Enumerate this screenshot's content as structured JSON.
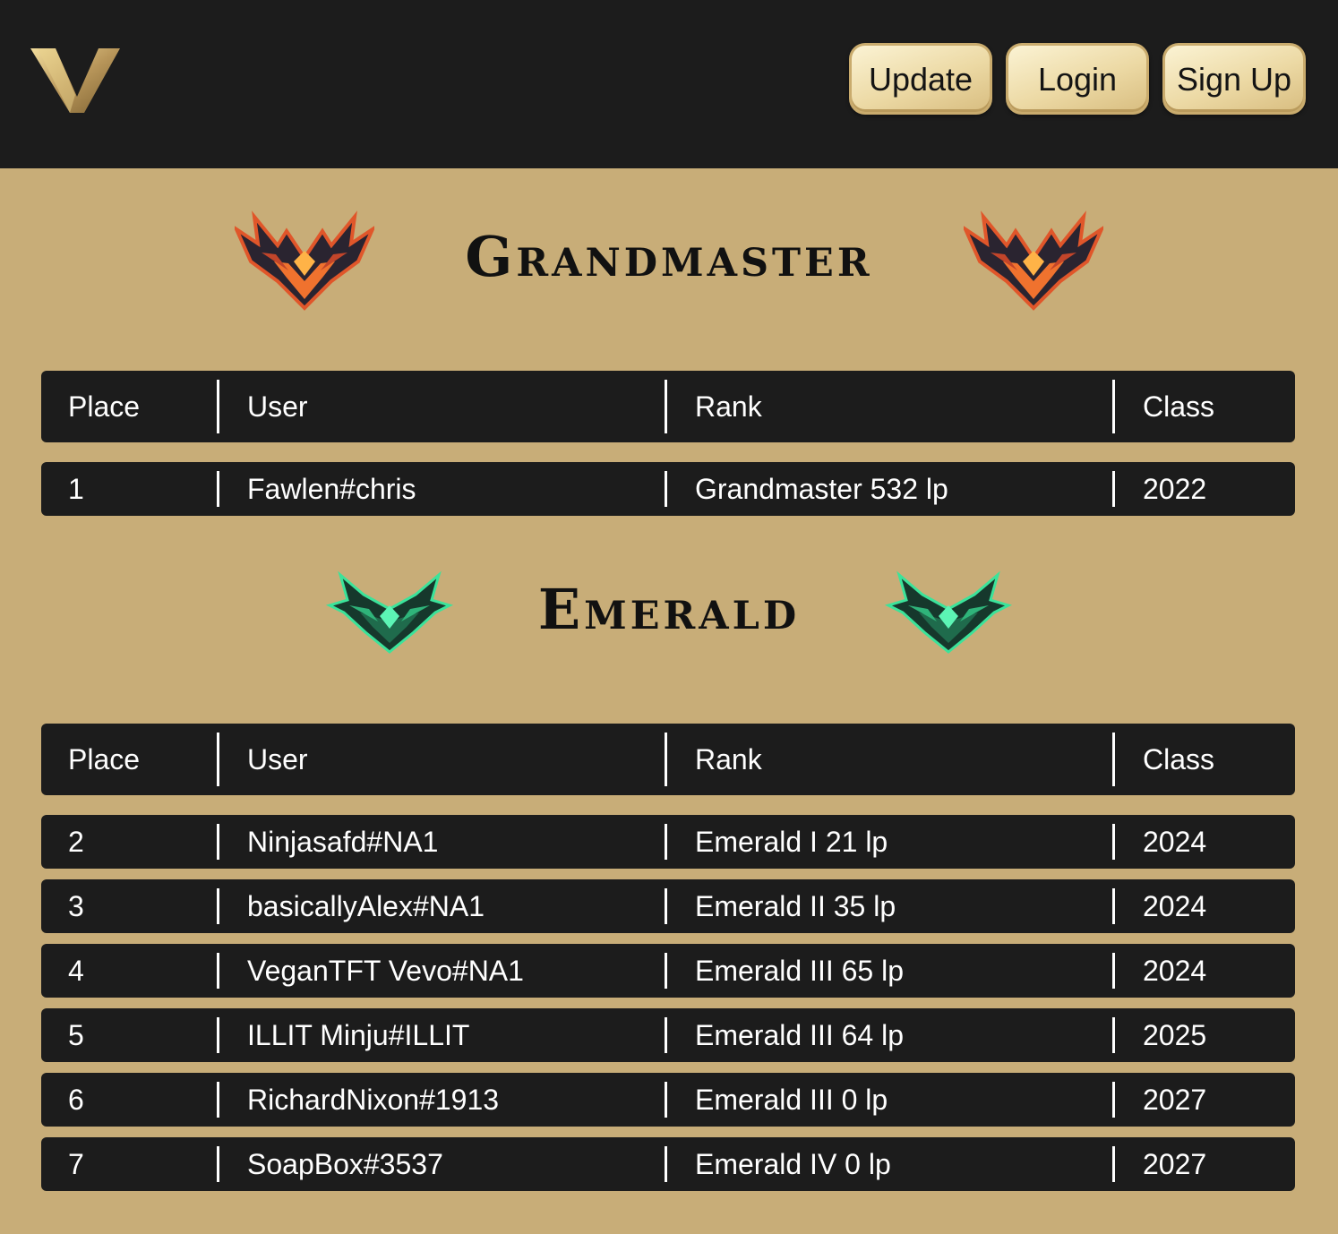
{
  "header": {
    "logo": "V-logo",
    "buttons": {
      "update": "Update",
      "login": "Login",
      "signup": "Sign Up"
    }
  },
  "columns": {
    "place": "Place",
    "user": "User",
    "rank": "Rank",
    "class": "Class"
  },
  "tiers": [
    {
      "title": "Grandmaster",
      "emblem": "grandmaster-emblem-icon",
      "accent": "#e0562a",
      "rows": [
        {
          "place": "1",
          "user": "Fawlen#chris",
          "rank": "Grandmaster 532 lp",
          "class": "2022"
        }
      ]
    },
    {
      "title": "Emerald",
      "emblem": "emerald-emblem-icon",
      "accent": "#2fd58a",
      "rows": [
        {
          "place": "2",
          "user": "Ninjasafd#NA1",
          "rank": "Emerald I 21 lp",
          "class": "2024"
        },
        {
          "place": "3",
          "user": "basicallyAlex#NA1",
          "rank": "Emerald II 35 lp",
          "class": "2024"
        },
        {
          "place": "4",
          "user": "VeganTFT Vevo#NA1",
          "rank": "Emerald III 65 lp",
          "class": "2024"
        },
        {
          "place": "5",
          "user": "ILLIT Minju#ILLIT",
          "rank": "Emerald III 64 lp",
          "class": "2025"
        },
        {
          "place": "6",
          "user": "RichardNixon#1913",
          "rank": "Emerald III 0 lp",
          "class": "2027"
        },
        {
          "place": "7",
          "user": "SoapBox#3537",
          "rank": "Emerald IV 0 lp",
          "class": "2027"
        }
      ]
    }
  ],
  "colors": {
    "header_bg": "#1c1c1c",
    "page_bg": "#c8ad78",
    "button_gold": "#ecd9a4"
  }
}
